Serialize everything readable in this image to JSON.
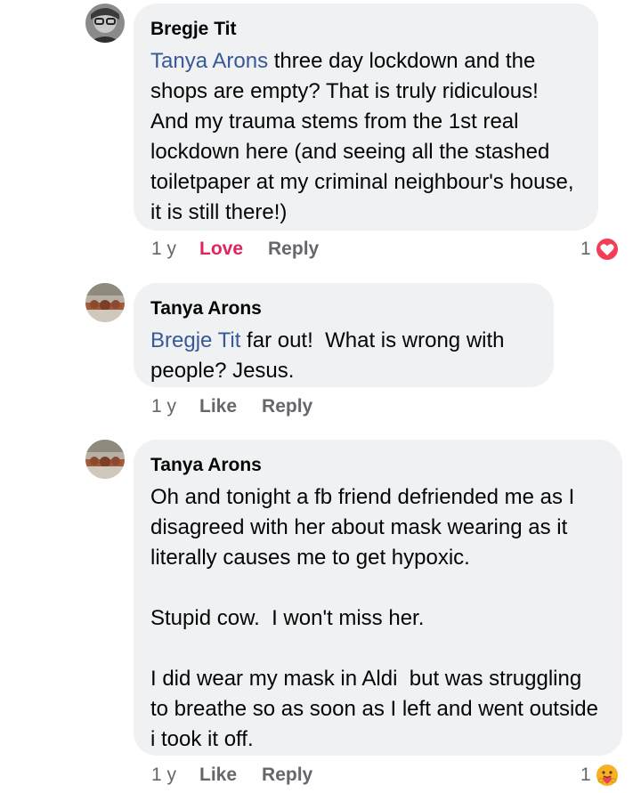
{
  "comments": [
    {
      "author": "Bregje Tit",
      "mention": "Tanya Arons",
      "text": " three day lockdown and the shops are empty? That is truly ridiculous! And my trauma stems from the 1st real lockdown here (and seeing all the stashed toiletpaper at my criminal neighbour's house, it is still there!)",
      "time": "1 y",
      "reaction_label": "Love",
      "reply_label": "Reply",
      "reaction_count": "1",
      "reaction_icon": "heart-reaction-icon",
      "reaction_color": "#f33e58"
    },
    {
      "author": "Tanya Arons",
      "mention": "Bregje Tit",
      "text": " far out!  What is wrong with people? Jesus.",
      "time": "1 y",
      "reaction_label": "Like",
      "reply_label": "Reply"
    },
    {
      "author": "Tanya Arons",
      "text": "Oh and tonight a fb friend defriended me as I disagreed with her about mask wearing as it literally causes me to get hypoxic.\n\nStupid cow.  I won't miss her.\n\nI did wear my mask in Aldi  but was struggling to breathe so as soon as I left and went outside i took it off.",
      "time": "1 y",
      "reaction_label": "Like",
      "reply_label": "Reply",
      "reaction_count": "1",
      "reaction_icon": "care-reaction-icon",
      "reaction_color": "#f7b125"
    }
  ]
}
